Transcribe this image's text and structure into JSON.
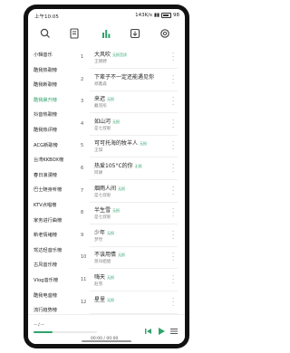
{
  "statusbar": {
    "time": "上午10:05",
    "network": "143K/s",
    "battery": "98"
  },
  "toolbar": {
    "icons": [
      "search-icon",
      "playlist-icon",
      "chart-icon",
      "download-icon",
      "settings-icon"
    ],
    "active_color": "#2fa36b"
  },
  "sidebar": {
    "items": [
      {
        "label": "小辑音乐",
        "active": false
      },
      {
        "label": "酷我热歌榜",
        "active": false
      },
      {
        "label": "酷我新歌榜",
        "active": false
      },
      {
        "label": "酷我飙升榜",
        "active": true
      },
      {
        "label": "抖音热歌榜",
        "active": false
      },
      {
        "label": "酷我热评榜",
        "active": false
      },
      {
        "label": "ACG新歌榜",
        "active": false
      },
      {
        "label": "台湾KKBOX榜",
        "active": false
      },
      {
        "label": "春日浪漫榜",
        "active": false
      },
      {
        "label": "巴士随身听榜",
        "active": false
      },
      {
        "label": "KTV点唱榜",
        "active": false
      },
      {
        "label": "家务进行曲榜",
        "active": false
      },
      {
        "label": "新老情绪榜",
        "active": false
      },
      {
        "label": "驾达轻音乐榜",
        "active": false
      },
      {
        "label": "古风音乐榜",
        "active": false
      },
      {
        "label": "Vlog音乐榜",
        "active": false
      },
      {
        "label": "酷我电音榜",
        "active": false
      },
      {
        "label": "流行趋势榜",
        "active": false
      }
    ]
  },
  "songs": [
    {
      "rank": "1",
      "title": "大风吹",
      "badge": "无损音质",
      "artist": "王赫野"
    },
    {
      "rank": "2",
      "title": "下辈子不一定还能遇见你",
      "badge": "",
      "artist": "郑鑫森"
    },
    {
      "rank": "3",
      "title": "来迟",
      "badge": "无损",
      "artist": "戴羽彤"
    },
    {
      "rank": "4",
      "title": "如山河",
      "badge": "无损",
      "artist": "是七叔呢"
    },
    {
      "rank": "5",
      "title": "可可托海的牧羊人",
      "badge": "无损",
      "artist": "王琪"
    },
    {
      "rank": "6",
      "title": "热爱105°C的你",
      "badge": "无损",
      "artist": "阿肆"
    },
    {
      "rank": "7",
      "title": "烟雨人间",
      "badge": "无损",
      "artist": "是七叔呢"
    },
    {
      "rank": "8",
      "title": "半生雪",
      "badge": "无损",
      "artist": "是七叔呢"
    },
    {
      "rank": "9",
      "title": "少年",
      "badge": "无损",
      "artist": "梦然"
    },
    {
      "rank": "10",
      "title": "不该用情",
      "badge": "无损",
      "artist": "莫叫姐姐"
    },
    {
      "rank": "11",
      "title": "嗨天",
      "badge": "无损",
      "artist": "赵雪"
    },
    {
      "rank": "12",
      "title": "星里",
      "badge": "无损",
      "artist": ""
    }
  ],
  "player": {
    "lyric": "—♪—",
    "current": "00:00",
    "total": "00:00",
    "progress": 0.3
  }
}
